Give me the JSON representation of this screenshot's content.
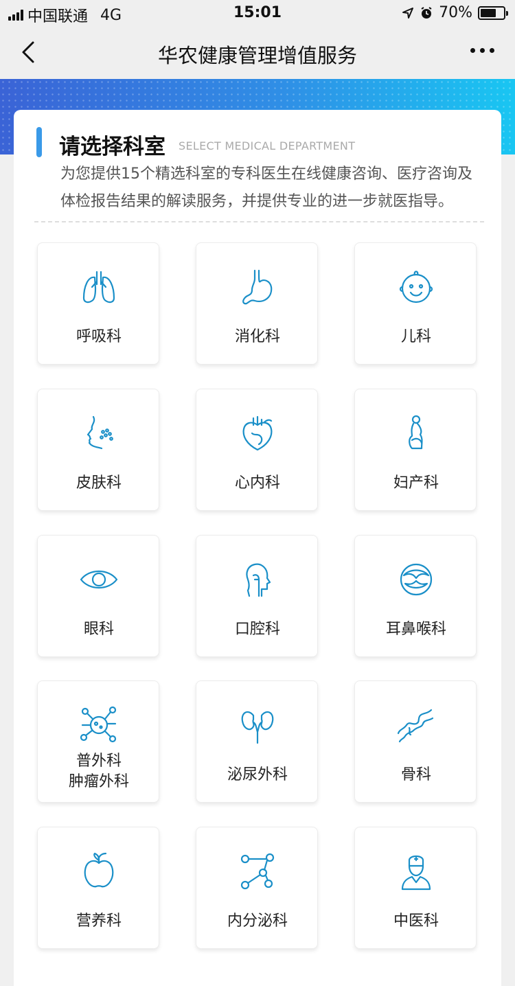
{
  "status_bar": {
    "carrier": "中国联通",
    "network": "4G",
    "time": "15:01",
    "battery": "70%",
    "battery_level": 0.7
  },
  "nav": {
    "title": "华农健康管理增值服务",
    "back_icon": "chevron-left-icon",
    "more_icon": "more-dots-icon"
  },
  "header": {
    "title": "请选择科室",
    "subtitle_en": "SELECT MEDICAL DEPARTMENT",
    "desc_line1": "为您提供15个精选科室的专科医生在线健康咨询、医疗咨询及",
    "desc_line2": "体检报告结果的解读服务，并提供专业的进一步就医指导。"
  },
  "accent_color": "#1a8fc8",
  "departments": [
    {
      "label": "呼吸科",
      "icon": "lungs-icon"
    },
    {
      "label": "消化科",
      "icon": "stomach-icon"
    },
    {
      "label": "儿科",
      "icon": "baby-face-icon"
    },
    {
      "label": "皮肤科",
      "icon": "skin-face-icon"
    },
    {
      "label": "心内科",
      "icon": "heart-icon"
    },
    {
      "label": "妇产科",
      "icon": "pregnant-woman-icon"
    },
    {
      "label": "眼科",
      "icon": "eye-icon"
    },
    {
      "label": "口腔科",
      "icon": "head-profile-icon"
    },
    {
      "label": "耳鼻喉科",
      "icon": "throat-icon"
    },
    {
      "label": "普外科",
      "label2": "肿瘤外科",
      "icon": "cell-icon"
    },
    {
      "label": "泌尿外科",
      "icon": "kidneys-icon"
    },
    {
      "label": "骨科",
      "icon": "bone-joint-icon"
    },
    {
      "label": "营养科",
      "icon": "apple-icon"
    },
    {
      "label": "内分泌科",
      "icon": "molecule-icon"
    },
    {
      "label": "中医科",
      "icon": "doctor-icon"
    }
  ]
}
